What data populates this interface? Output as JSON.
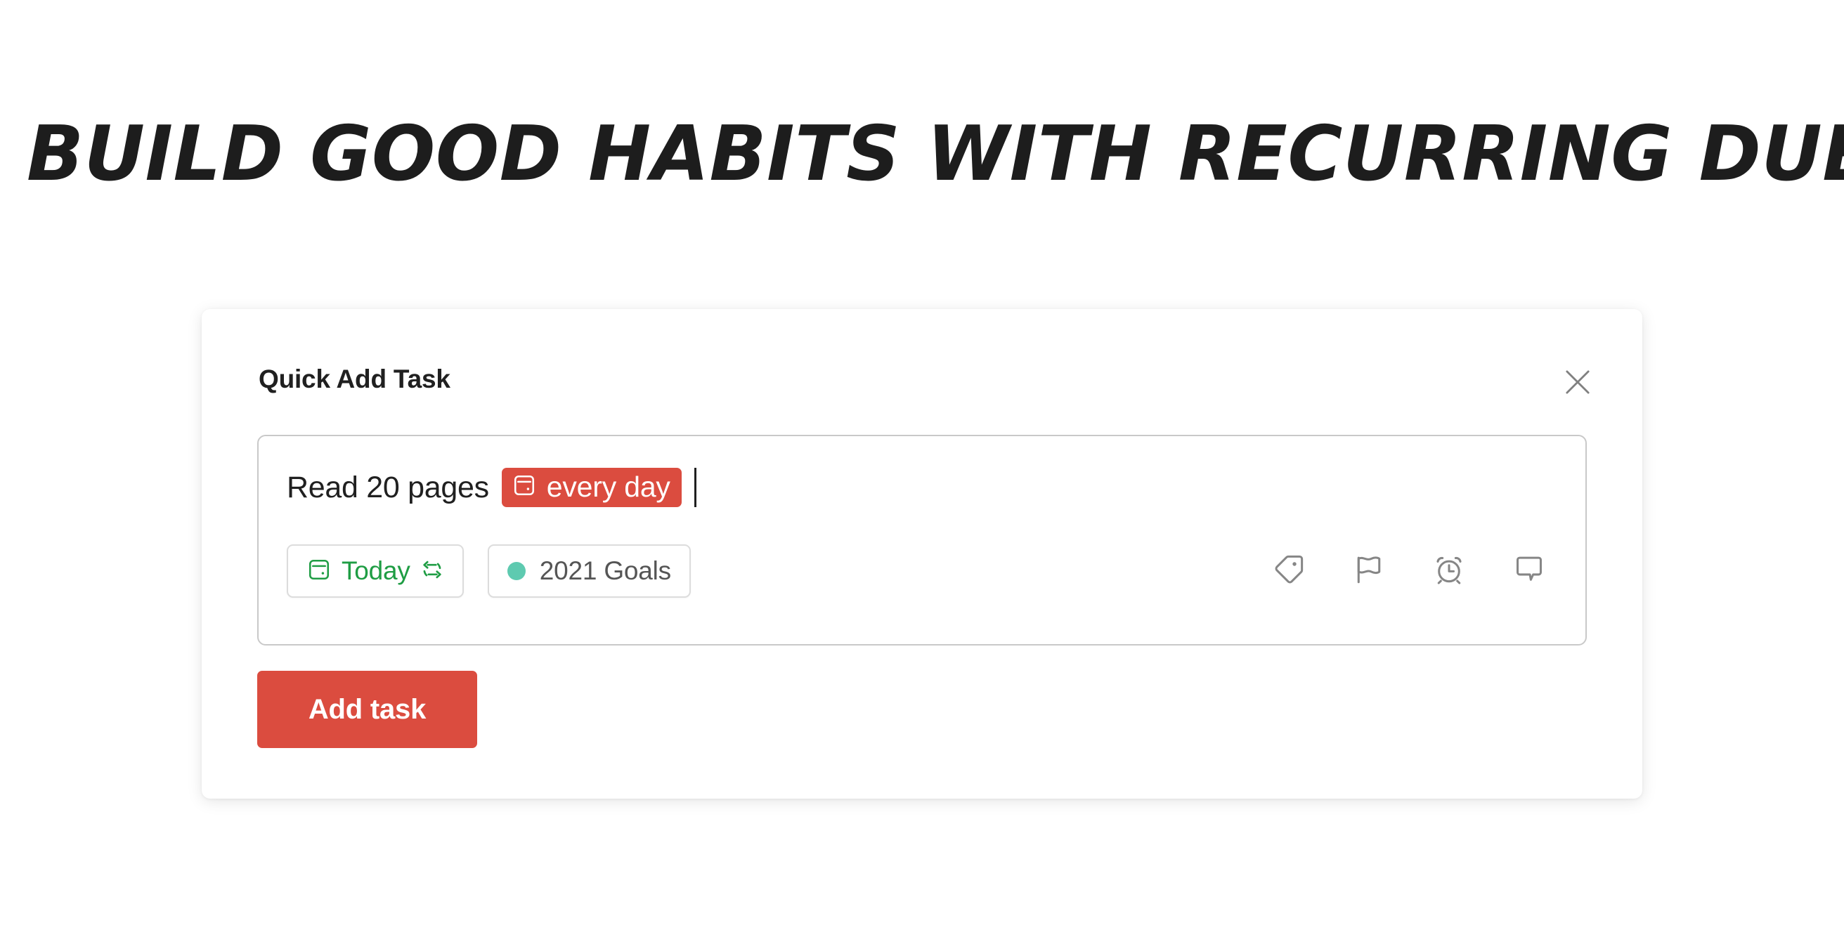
{
  "headline": "Build good habits with recurring due dates",
  "card": {
    "title": "Quick Add Task",
    "close_label": "Close",
    "close_icon": "close-icon"
  },
  "task_input": {
    "text": "Read 20 pages",
    "recurrence_chip": {
      "label": "every day",
      "icon": "calendar-icon",
      "background": "#db4c3f",
      "text_color": "#ffffff"
    },
    "caret_visible": true
  },
  "pills": {
    "date": {
      "label": "Today",
      "icon": "calendar-icon",
      "trailing_icon": "repeat-icon",
      "color": "#1f9d44"
    },
    "project": {
      "label": "2021 Goals",
      "icon": "project-dot",
      "dot_color": "#5ecab0",
      "color": "#555555"
    }
  },
  "action_icons": [
    {
      "name": "label-icon",
      "title": "Labels"
    },
    {
      "name": "flag-icon",
      "title": "Priority"
    },
    {
      "name": "alarm-clock-icon",
      "title": "Reminders"
    },
    {
      "name": "comment-icon",
      "title": "Comments"
    }
  ],
  "submit": {
    "label": "Add task"
  },
  "colors": {
    "accent_red": "#db4c3f",
    "green": "#1f9d44",
    "teal": "#5ecab0",
    "text_dark": "#202020",
    "border_gray": "#c9c9c9"
  }
}
